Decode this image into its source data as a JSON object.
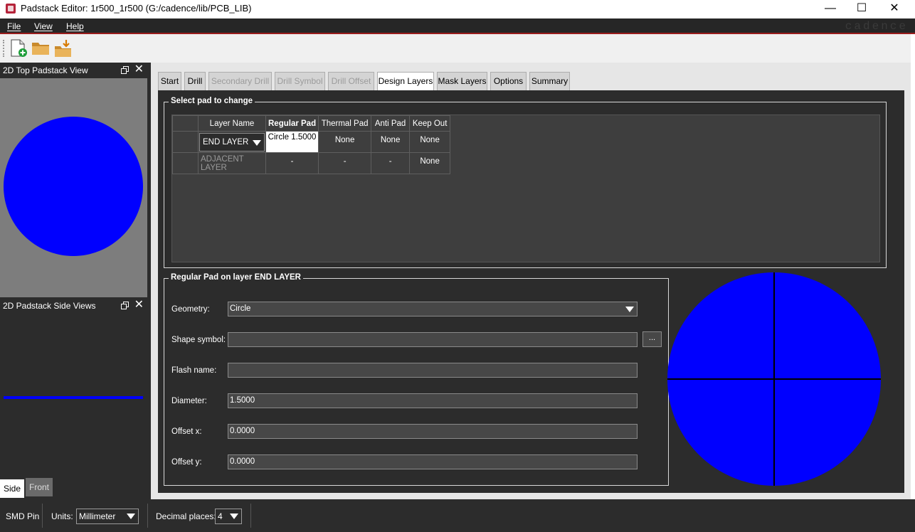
{
  "window": {
    "title": "Padstack Editor: 1r500_1r500  (G:/cadence/lib/PCB_LIB)",
    "minimize": "—",
    "maximize": "☐",
    "close": "✕"
  },
  "menu": {
    "file": "File",
    "view": "View",
    "help": "Help",
    "brand": "cadence"
  },
  "toolbar": {
    "icons": [
      "new-padstack-icon",
      "open-folder-icon",
      "load-folder-icon"
    ]
  },
  "left": {
    "top_view_title": "2D Top Padstack View",
    "side_view_title": "2D Padstack Side Views",
    "side_tabs": [
      "Side",
      "Front"
    ]
  },
  "tabs": [
    "Start",
    "Drill",
    "Secondary Drill",
    "Drill Symbol",
    "Drill Offset",
    "Design Layers",
    "Mask Layers",
    "Options",
    "Summary"
  ],
  "active_tab": "Design Layers",
  "select_group": {
    "title": "Select pad to change",
    "headers": [
      "Layer Name",
      "Regular Pad",
      "Thermal Pad",
      "Anti Pad",
      "Keep Out"
    ],
    "rows": [
      {
        "layer": "END LAYER",
        "regular": "Circle 1.5000",
        "thermal": "None",
        "anti": "None",
        "keepout": "None"
      },
      {
        "layer": "ADJACENT LAYER",
        "regular": "-",
        "thermal": "-",
        "anti": "-",
        "keepout": "None"
      }
    ]
  },
  "pad_group": {
    "title": "Regular Pad on layer END LAYER",
    "geometry_label": "Geometry:",
    "geometry_value": "Circle",
    "shape_label": "Shape symbol:",
    "shape_value": "",
    "browse_label": "...",
    "flash_label": "Flash name:",
    "flash_value": "",
    "diameter_label": "Diameter:",
    "diameter_value": "1.5000",
    "offsetx_label": "Offset x:",
    "offsetx_value": "0.0000",
    "offsety_label": "Offset y:",
    "offsety_value": "0.0000"
  },
  "status": {
    "pin_type": "SMD Pin",
    "units_label": "Units:",
    "units_value": "Millimeter",
    "decimal_label": "Decimal places:",
    "decimal_value": "4"
  },
  "colors": {
    "pad": "#0000ff",
    "panel": "#2c2c2c",
    "accent_line": "#9a1d1d"
  }
}
